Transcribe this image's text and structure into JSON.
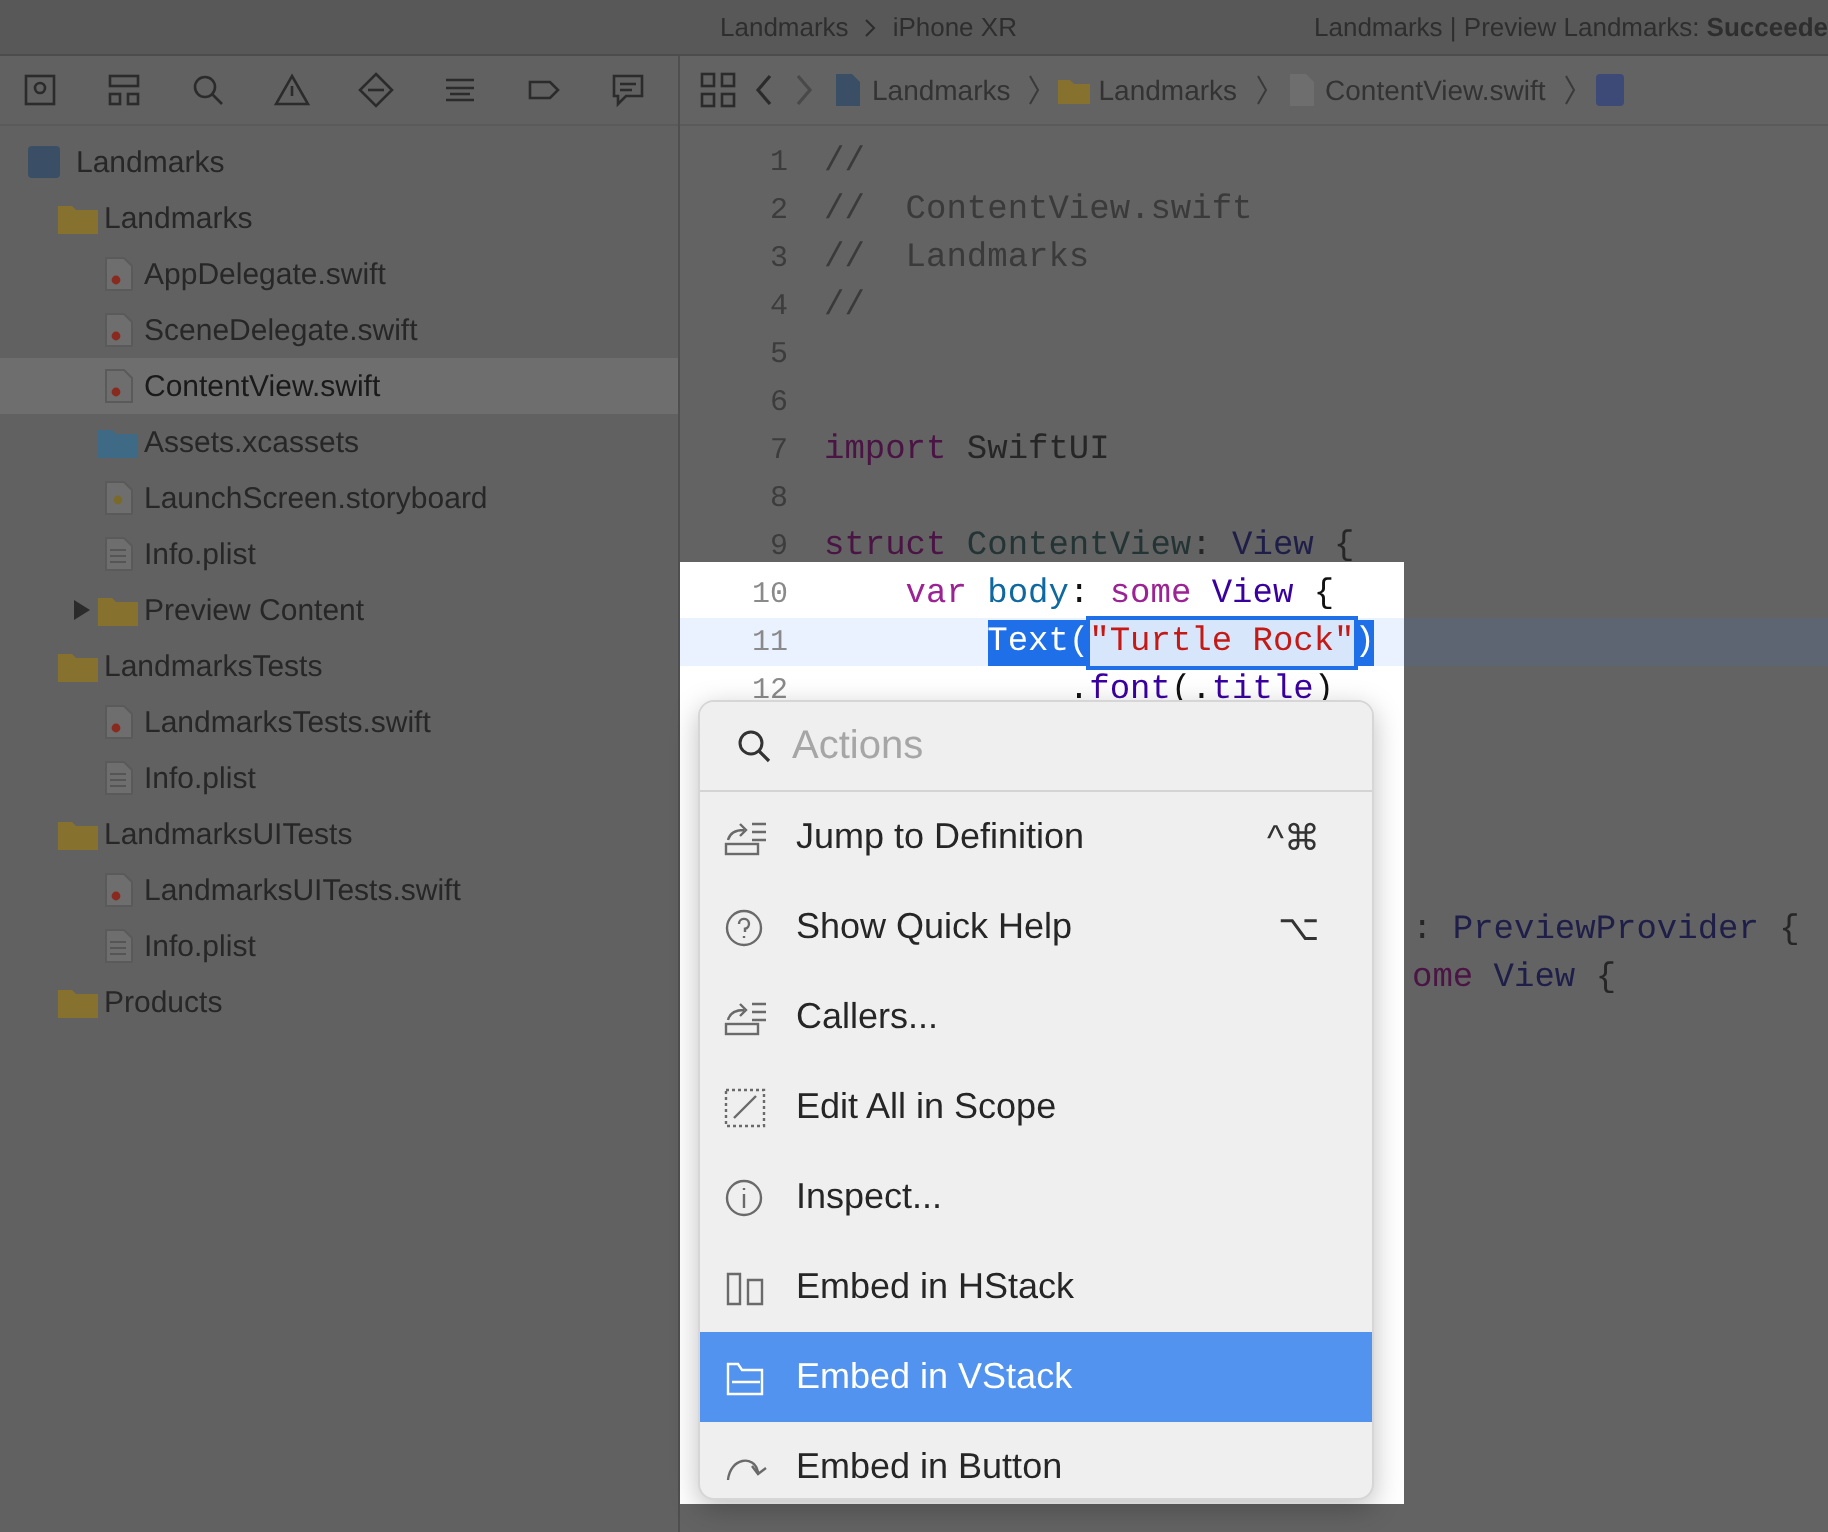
{
  "toolbar": {
    "scheme": "Landmarks",
    "device": "iPhone XR",
    "status": "Landmarks | Preview Landmarks: **Succeede**"
  },
  "navigator": {
    "items": [
      {
        "label": "Landmarks",
        "kind": "project",
        "expanded": true,
        "selected": false,
        "children": [
          {
            "label": "Landmarks",
            "kind": "folder",
            "expanded": true,
            "selected": false,
            "children": [
              {
                "label": "AppDelegate.swift",
                "kind": "swift",
                "selected": false
              },
              {
                "label": "SceneDelegate.swift",
                "kind": "swift",
                "selected": false
              },
              {
                "label": "ContentView.swift",
                "kind": "swift",
                "selected": true
              },
              {
                "label": "Assets.xcassets",
                "kind": "assets",
                "selected": false
              },
              {
                "label": "LaunchScreen.storyboard",
                "kind": "storyboard",
                "selected": false
              },
              {
                "label": "Info.plist",
                "kind": "plist",
                "selected": false
              },
              {
                "label": "Preview Content",
                "kind": "folder",
                "expanded": false,
                "selected": false
              }
            ]
          },
          {
            "label": "LandmarksTests",
            "kind": "folder",
            "expanded": true,
            "selected": false,
            "children": [
              {
                "label": "LandmarksTests.swift",
                "kind": "swift",
                "selected": false
              },
              {
                "label": "Info.plist",
                "kind": "plist",
                "selected": false
              }
            ]
          },
          {
            "label": "LandmarksUITests",
            "kind": "folder",
            "expanded": true,
            "selected": false,
            "children": [
              {
                "label": "LandmarksUITests.swift",
                "kind": "swift",
                "selected": false
              },
              {
                "label": "Info.plist",
                "kind": "plist",
                "selected": false
              }
            ]
          },
          {
            "label": "Products",
            "kind": "folder",
            "selected": false
          }
        ]
      }
    ]
  },
  "jump_bar": [
    {
      "label": "Landmarks",
      "kind": "project"
    },
    {
      "label": "Landmarks",
      "kind": "folder"
    },
    {
      "label": "ContentView.swift",
      "kind": "swift"
    }
  ],
  "editor": {
    "lines": [
      {
        "number": "1",
        "lit": false,
        "current": false,
        "tokens": [
          {
            "text": "//",
            "kind": "comment"
          }
        ]
      },
      {
        "number": "2",
        "lit": false,
        "current": false,
        "tokens": [
          {
            "text": "//  ContentView.swift",
            "kind": "comment"
          }
        ]
      },
      {
        "number": "3",
        "lit": false,
        "current": false,
        "tokens": [
          {
            "text": "//  Landmarks",
            "kind": "comment"
          }
        ]
      },
      {
        "number": "4",
        "lit": false,
        "current": false,
        "tokens": [
          {
            "text": "//",
            "kind": "comment"
          }
        ]
      },
      {
        "number": "5",
        "lit": false,
        "current": false
      },
      {
        "number": "6",
        "lit": false,
        "current": false
      },
      {
        "number": "7",
        "lit": false,
        "current": false,
        "tokens": [
          {
            "text": "import",
            "kind": "keyword"
          },
          {
            "text": " SwiftUI",
            "kind": "plain"
          }
        ]
      },
      {
        "number": "8",
        "lit": false,
        "current": false
      },
      {
        "number": "9",
        "lit": false,
        "current": false,
        "tokens": [
          {
            "text": "struct",
            "kind": "keyword"
          },
          {
            "text": " ContentView",
            "kind": "decl"
          },
          {
            "text": ": ",
            "kind": "plain"
          },
          {
            "text": "View",
            "kind": "type"
          },
          {
            "text": " {",
            "kind": "plain"
          }
        ]
      },
      {
        "number": "10",
        "lit": true,
        "current": false,
        "tokens": [
          {
            "text": "    var",
            "kind": "keyword"
          },
          {
            "text": " body",
            "kind": "property"
          },
          {
            "text": ": ",
            "kind": "plain"
          },
          {
            "text": "some",
            "kind": "keyword"
          },
          {
            "text": " View",
            "kind": "type"
          },
          {
            "text": " {",
            "kind": "plain"
          }
        ]
      },
      {
        "number": "11",
        "lit": true,
        "current": true,
        "tokens": [
          {
            "text": "        Text(",
            "kind": "plain",
            "highlighted": true
          },
          {
            "text": "\"Turtle Rock\"",
            "kind": "string",
            "highlighted": true
          },
          {
            "text": ")",
            "kind": "plain",
            "highlighted": true
          }
        ]
      },
      {
        "number": "12",
        "lit": true,
        "current": false,
        "tokens": [
          {
            "text": "            .",
            "kind": "plain"
          },
          {
            "text": "font",
            "kind": "type"
          },
          {
            "text": "(.",
            "kind": "plain"
          },
          {
            "text": "title",
            "kind": "type"
          },
          {
            "text": ")",
            "kind": "plain"
          }
        ]
      }
    ],
    "fragments": [
      {
        "tokens": [
          {
            "text": ": ",
            "kind": "plain"
          },
          {
            "text": "PreviewProvider",
            "kind": "type"
          },
          {
            "text": " {",
            "kind": "plain"
          }
        ]
      },
      {
        "tokens": [
          {
            "text": "ome",
            "kind": "keyword"
          },
          {
            "text": " View",
            "kind": "type"
          },
          {
            "text": " {",
            "kind": "plain"
          }
        ]
      }
    ]
  },
  "actions_menu": {
    "placeholder": "Actions",
    "items": [
      {
        "label": "Jump to Definition",
        "shortcut": "^⌘",
        "selected": false
      },
      {
        "label": "Show Quick Help",
        "shortcut": "⌥",
        "selected": false
      },
      {
        "label": "Callers...",
        "selected": false
      },
      {
        "label": "Edit All in Scope",
        "selected": false
      },
      {
        "label": "Inspect...",
        "selected": false
      },
      {
        "label": "Embed in HStack",
        "selected": false
      },
      {
        "label": "Embed in VStack",
        "selected": true
      },
      {
        "label": "Embed in Button",
        "selected": false
      }
    ]
  }
}
